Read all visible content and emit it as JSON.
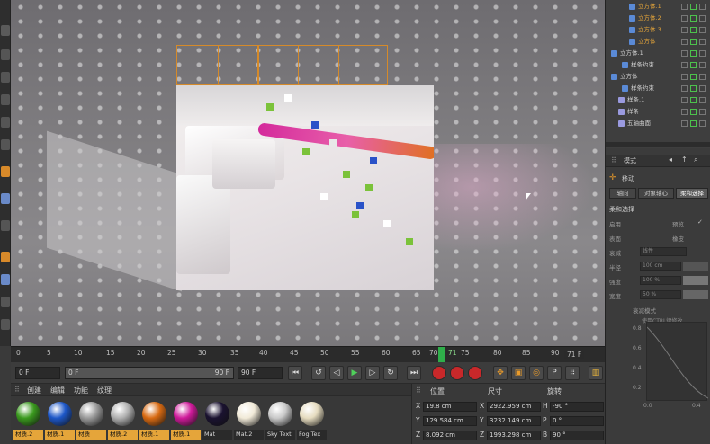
{
  "timeline": {
    "ticks": [
      "0",
      "5",
      "10",
      "15",
      "20",
      "25",
      "30",
      "35",
      "40",
      "45",
      "50",
      "55",
      "60",
      "65",
      "70",
      "75",
      "80",
      "85",
      "90"
    ],
    "playhead": "71",
    "end_frame": "71 F"
  },
  "transport": {
    "start": "0 F",
    "range_start": "0 F",
    "range_end": "90 F",
    "max": "90 F"
  },
  "materials": {
    "menu": [
      "创建",
      "编辑",
      "功能",
      "纹理"
    ],
    "items": [
      {
        "label": "材质.2",
        "color": "#3a9a1e",
        "style": "orange"
      },
      {
        "label": "材质.1",
        "color": "#1d57c8",
        "style": "orange"
      },
      {
        "label": "材质",
        "color": "#9a9a9a",
        "style": "orange"
      },
      {
        "label": "材质.2",
        "color": "#b0b0b0",
        "style": "orange"
      },
      {
        "label": "材质.1",
        "color": "#d86a12",
        "style": "orange"
      },
      {
        "label": "材质.1",
        "color": "#cf1a9a",
        "style": "orange"
      },
      {
        "label": "Mat",
        "color": "#1a1230",
        "style": "plain"
      },
      {
        "label": "Mat.2",
        "color": "#f1ead8",
        "style": "plain"
      },
      {
        "label": "Sky Text",
        "color": "#c9c9c9",
        "style": "plain"
      },
      {
        "label": "Fog Tex",
        "color": "#e6dcc0",
        "style": "plain"
      }
    ]
  },
  "coords": {
    "headers": [
      "位置",
      "尺寸",
      "旋转"
    ],
    "rows": [
      {
        "axis": "X",
        "pos": "19.8 cm",
        "size": "2922.959 cm",
        "rot_axis": "H",
        "rot": "-90 °"
      },
      {
        "axis": "Y",
        "pos": "129.584 cm",
        "size": "3232.149 cm",
        "rot_axis": "P",
        "rot": "0 °"
      },
      {
        "axis": "Z",
        "pos": "8.092 cm",
        "size": "1993.298 cm",
        "rot_axis": "B",
        "rot": "90 °"
      }
    ]
  },
  "objects": [
    {
      "label": "立方体.1",
      "color": "#e5a53a"
    },
    {
      "label": "立方体.2",
      "color": "#e5a53a"
    },
    {
      "label": "立方体.3",
      "color": "#e5a53a"
    },
    {
      "label": "立方体",
      "color": "#e5a53a"
    },
    {
      "label": "立方体.1",
      "color": "#cfcfcf"
    },
    {
      "label": "样条约束",
      "color": "#cfcfcf"
    },
    {
      "label": "立方体",
      "color": "#cfcfcf"
    },
    {
      "label": "样条约束",
      "color": "#cfcfcf"
    },
    {
      "label": "样条.1",
      "color": "#cfcfcf"
    },
    {
      "label": "样条",
      "color": "#cfcfcf"
    },
    {
      "label": "五轴曲面",
      "color": "#cfcfcf"
    }
  ],
  "attributes": {
    "mode_label": "模式",
    "move_label": "移动",
    "tabs": [
      "轴向",
      "对象轴心",
      "柔和选择"
    ],
    "section": "柔和选择",
    "rows": [
      "启用",
      "表面",
      "衰减",
      "半径",
      "强度",
      "宽度"
    ],
    "right_labels": [
      "预览",
      "橡皮"
    ],
    "mode_value": "线性",
    "radius": "100 cm",
    "strength": "100 %",
    "width": "50 %",
    "footer": "衰减模式",
    "hint": "使用CTRL键修改",
    "graph_y": [
      "0.8",
      "0.6",
      "0.4",
      "0.2"
    ],
    "graph_x": [
      "0.0",
      "0.4"
    ]
  }
}
